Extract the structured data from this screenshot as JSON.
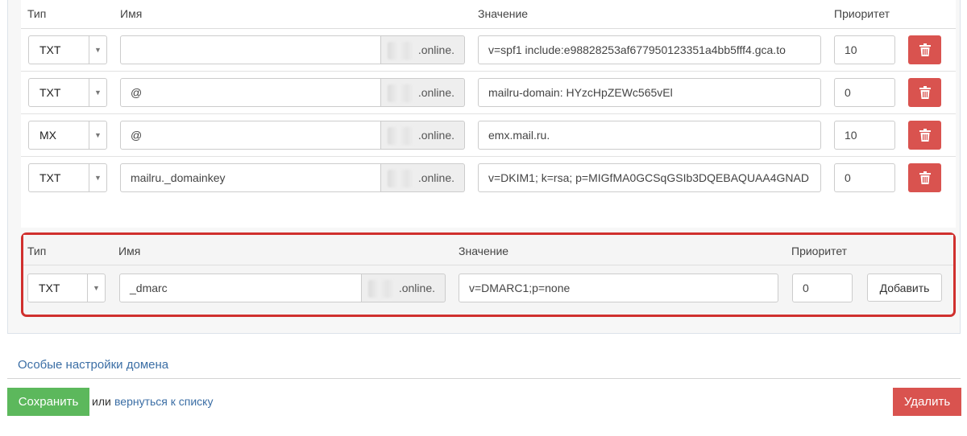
{
  "headers": {
    "type": "Тип",
    "name": "Имя",
    "value": "Значение",
    "priority": "Приоритет"
  },
  "domain_suffix": ".online.",
  "records": [
    {
      "type": "TXT",
      "name": "",
      "value": "v=spf1 include:e98828253af677950123351a4bb5fff4.gca.to",
      "priority": "10"
    },
    {
      "type": "TXT",
      "name": "@",
      "value": "mailru-domain: HYzcHpZEWc565vEl",
      "priority": "0"
    },
    {
      "type": "MX",
      "name": "@",
      "value": "emx.mail.ru.",
      "priority": "10"
    },
    {
      "type": "TXT",
      "name": "mailru._domainkey",
      "value": "v=DKIM1; k=rsa; p=MIGfMA0GCSqGSIb3DQEBAQUAA4GNAD",
      "priority": "0"
    }
  ],
  "new_record": {
    "type": "TXT",
    "name": "_dmarc",
    "value": "v=DMARC1;p=none",
    "priority": "0",
    "add_label": "Добавить"
  },
  "footer": {
    "settings_link": "Особые настройки домена",
    "save_label": "Сохранить",
    "or_text": "или",
    "back_link": "вернуться к списку",
    "delete_label": "Удалить"
  },
  "colors": {
    "danger": "#d9534f",
    "success": "#5cb85c",
    "highlight_border": "#d0302e",
    "link": "#3b6ea5"
  },
  "icons": {
    "delete_row": "trash-icon",
    "select_arrow": "caret-down-icon"
  }
}
